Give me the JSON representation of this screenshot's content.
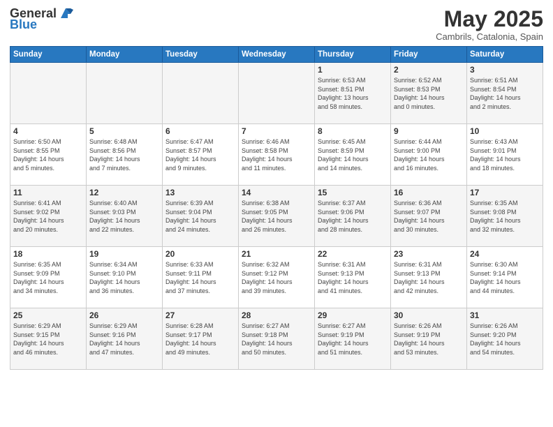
{
  "logo": {
    "line1": "General",
    "line2": "Blue"
  },
  "title": "May 2025",
  "subtitle": "Cambrils, Catalonia, Spain",
  "weekdays": [
    "Sunday",
    "Monday",
    "Tuesday",
    "Wednesday",
    "Thursday",
    "Friday",
    "Saturday"
  ],
  "weeks": [
    [
      {
        "day": "",
        "info": ""
      },
      {
        "day": "",
        "info": ""
      },
      {
        "day": "",
        "info": ""
      },
      {
        "day": "",
        "info": ""
      },
      {
        "day": "1",
        "info": "Sunrise: 6:53 AM\nSunset: 8:51 PM\nDaylight: 13 hours\nand 58 minutes."
      },
      {
        "day": "2",
        "info": "Sunrise: 6:52 AM\nSunset: 8:53 PM\nDaylight: 14 hours\nand 0 minutes."
      },
      {
        "day": "3",
        "info": "Sunrise: 6:51 AM\nSunset: 8:54 PM\nDaylight: 14 hours\nand 2 minutes."
      }
    ],
    [
      {
        "day": "4",
        "info": "Sunrise: 6:50 AM\nSunset: 8:55 PM\nDaylight: 14 hours\nand 5 minutes."
      },
      {
        "day": "5",
        "info": "Sunrise: 6:48 AM\nSunset: 8:56 PM\nDaylight: 14 hours\nand 7 minutes."
      },
      {
        "day": "6",
        "info": "Sunrise: 6:47 AM\nSunset: 8:57 PM\nDaylight: 14 hours\nand 9 minutes."
      },
      {
        "day": "7",
        "info": "Sunrise: 6:46 AM\nSunset: 8:58 PM\nDaylight: 14 hours\nand 11 minutes."
      },
      {
        "day": "8",
        "info": "Sunrise: 6:45 AM\nSunset: 8:59 PM\nDaylight: 14 hours\nand 14 minutes."
      },
      {
        "day": "9",
        "info": "Sunrise: 6:44 AM\nSunset: 9:00 PM\nDaylight: 14 hours\nand 16 minutes."
      },
      {
        "day": "10",
        "info": "Sunrise: 6:43 AM\nSunset: 9:01 PM\nDaylight: 14 hours\nand 18 minutes."
      }
    ],
    [
      {
        "day": "11",
        "info": "Sunrise: 6:41 AM\nSunset: 9:02 PM\nDaylight: 14 hours\nand 20 minutes."
      },
      {
        "day": "12",
        "info": "Sunrise: 6:40 AM\nSunset: 9:03 PM\nDaylight: 14 hours\nand 22 minutes."
      },
      {
        "day": "13",
        "info": "Sunrise: 6:39 AM\nSunset: 9:04 PM\nDaylight: 14 hours\nand 24 minutes."
      },
      {
        "day": "14",
        "info": "Sunrise: 6:38 AM\nSunset: 9:05 PM\nDaylight: 14 hours\nand 26 minutes."
      },
      {
        "day": "15",
        "info": "Sunrise: 6:37 AM\nSunset: 9:06 PM\nDaylight: 14 hours\nand 28 minutes."
      },
      {
        "day": "16",
        "info": "Sunrise: 6:36 AM\nSunset: 9:07 PM\nDaylight: 14 hours\nand 30 minutes."
      },
      {
        "day": "17",
        "info": "Sunrise: 6:35 AM\nSunset: 9:08 PM\nDaylight: 14 hours\nand 32 minutes."
      }
    ],
    [
      {
        "day": "18",
        "info": "Sunrise: 6:35 AM\nSunset: 9:09 PM\nDaylight: 14 hours\nand 34 minutes."
      },
      {
        "day": "19",
        "info": "Sunrise: 6:34 AM\nSunset: 9:10 PM\nDaylight: 14 hours\nand 36 minutes."
      },
      {
        "day": "20",
        "info": "Sunrise: 6:33 AM\nSunset: 9:11 PM\nDaylight: 14 hours\nand 37 minutes."
      },
      {
        "day": "21",
        "info": "Sunrise: 6:32 AM\nSunset: 9:12 PM\nDaylight: 14 hours\nand 39 minutes."
      },
      {
        "day": "22",
        "info": "Sunrise: 6:31 AM\nSunset: 9:13 PM\nDaylight: 14 hours\nand 41 minutes."
      },
      {
        "day": "23",
        "info": "Sunrise: 6:31 AM\nSunset: 9:13 PM\nDaylight: 14 hours\nand 42 minutes."
      },
      {
        "day": "24",
        "info": "Sunrise: 6:30 AM\nSunset: 9:14 PM\nDaylight: 14 hours\nand 44 minutes."
      }
    ],
    [
      {
        "day": "25",
        "info": "Sunrise: 6:29 AM\nSunset: 9:15 PM\nDaylight: 14 hours\nand 46 minutes."
      },
      {
        "day": "26",
        "info": "Sunrise: 6:29 AM\nSunset: 9:16 PM\nDaylight: 14 hours\nand 47 minutes."
      },
      {
        "day": "27",
        "info": "Sunrise: 6:28 AM\nSunset: 9:17 PM\nDaylight: 14 hours\nand 49 minutes."
      },
      {
        "day": "28",
        "info": "Sunrise: 6:27 AM\nSunset: 9:18 PM\nDaylight: 14 hours\nand 50 minutes."
      },
      {
        "day": "29",
        "info": "Sunrise: 6:27 AM\nSunset: 9:19 PM\nDaylight: 14 hours\nand 51 minutes."
      },
      {
        "day": "30",
        "info": "Sunrise: 6:26 AM\nSunset: 9:19 PM\nDaylight: 14 hours\nand 53 minutes."
      },
      {
        "day": "31",
        "info": "Sunrise: 6:26 AM\nSunset: 9:20 PM\nDaylight: 14 hours\nand 54 minutes."
      }
    ]
  ]
}
